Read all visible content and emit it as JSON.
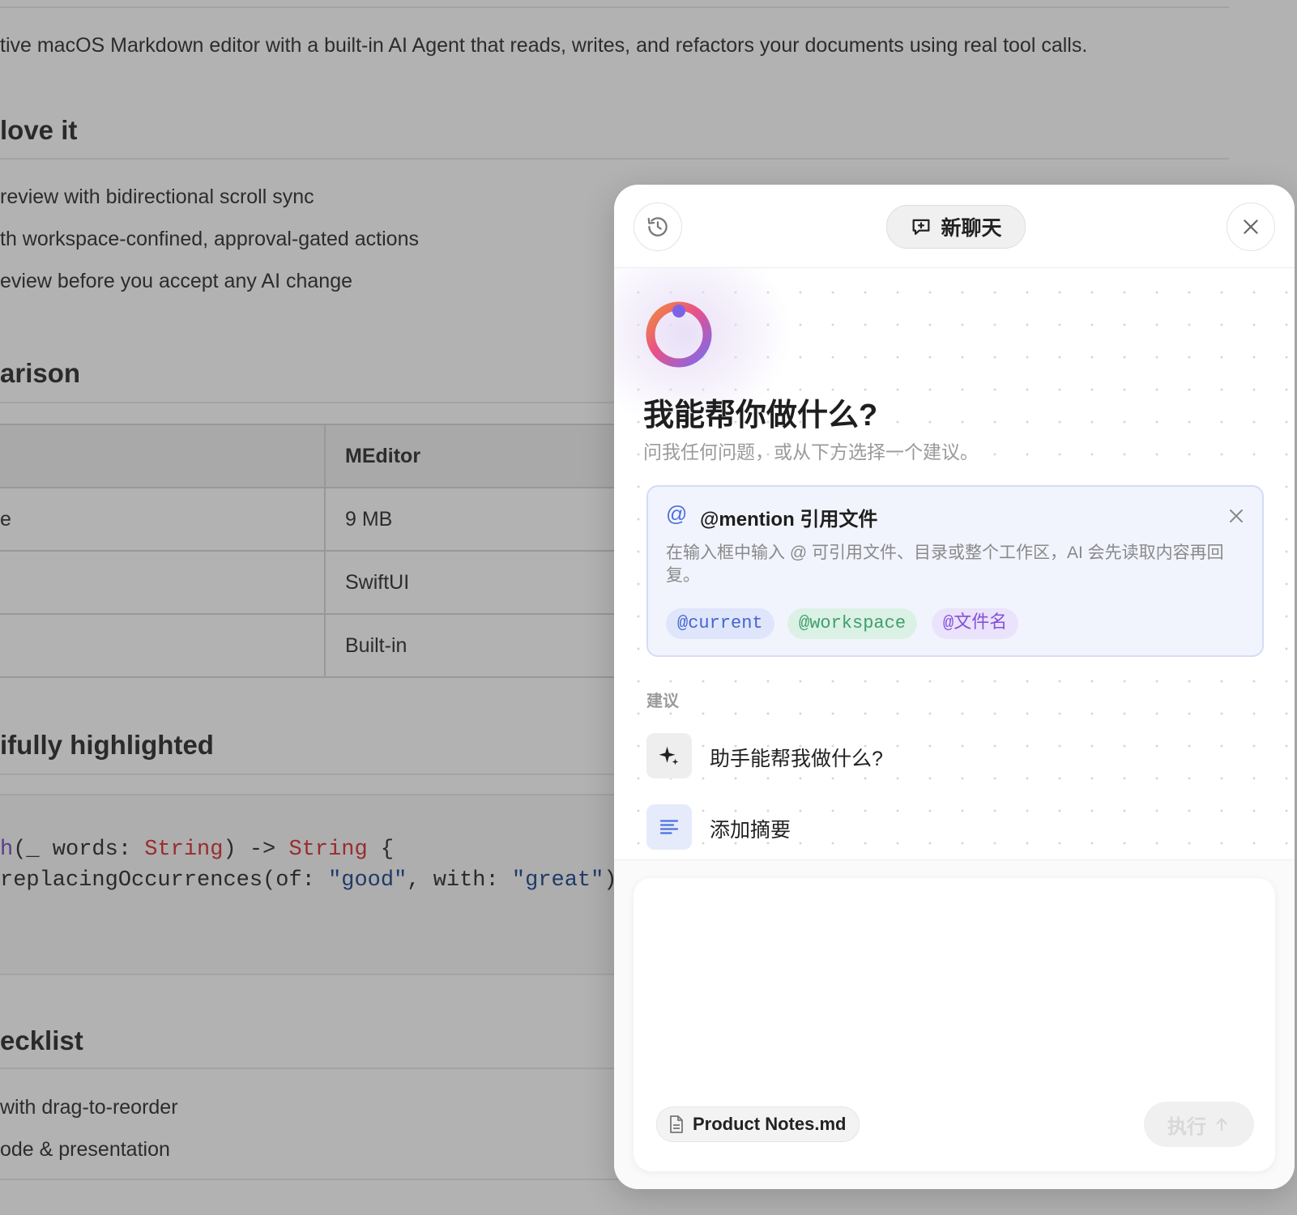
{
  "document": {
    "intro": "tive macOS Markdown editor with a built-in AI Agent that reads, writes, and refactors your documents using real tool calls.",
    "love_heading": "love it",
    "love_items": [
      "review with bidirectional scroll sync",
      "th workspace-confined, approval-gated actions",
      "eview before you accept any AI change"
    ],
    "comparison_heading": "arison",
    "table": {
      "header": [
        "",
        "MEditor"
      ],
      "rows": [
        [
          "e",
          "9 MB"
        ],
        [
          "",
          "SwiftUI"
        ],
        [
          "",
          "Built-in"
        ]
      ]
    },
    "code_heading": "ifully highlighted",
    "code": {
      "line1": {
        "fn": "h",
        "a": "(_ words: ",
        "t1": "String",
        "b": ") -> ",
        "t2": "String",
        "c": " {"
      },
      "line2": {
        "a": "replacingOccurrences(of: ",
        "s1": "\"good\"",
        "b": ", with: ",
        "s2": "\"great\"",
        "c": ")"
      }
    },
    "checklist_heading": "ecklist",
    "checklist_items": [
      "with drag-to-reorder",
      "ode & presentation"
    ]
  },
  "panel": {
    "header": {
      "new_chat_label": "新聊天",
      "history_icon": "history-icon",
      "close_icon": "close-icon"
    },
    "hero": {
      "title": "我能帮你做什么?",
      "subtitle": "问我任何问题，或从下方选择一个建议。"
    },
    "mention_card": {
      "at_symbol": "@",
      "title": "@mention 引用文件",
      "description": "在输入框中输入 @ 可引用文件、目录或整个工作区，AI 会先读取内容再回复。",
      "chips": [
        "@current",
        "@workspace",
        "@文件名"
      ]
    },
    "suggestions": {
      "label": "建议",
      "items": [
        {
          "label": "助手能帮我做什么?",
          "icon": "sparkle-icon"
        },
        {
          "label": "添加摘要",
          "icon": "text-lines-icon"
        }
      ]
    },
    "composer": {
      "file_chip": "Product Notes.md",
      "run_label": "执行"
    },
    "colors": {
      "accent_blue": "#4c6fe0",
      "chip_green": "#3f9f6c",
      "chip_purple": "#8352d8"
    }
  }
}
